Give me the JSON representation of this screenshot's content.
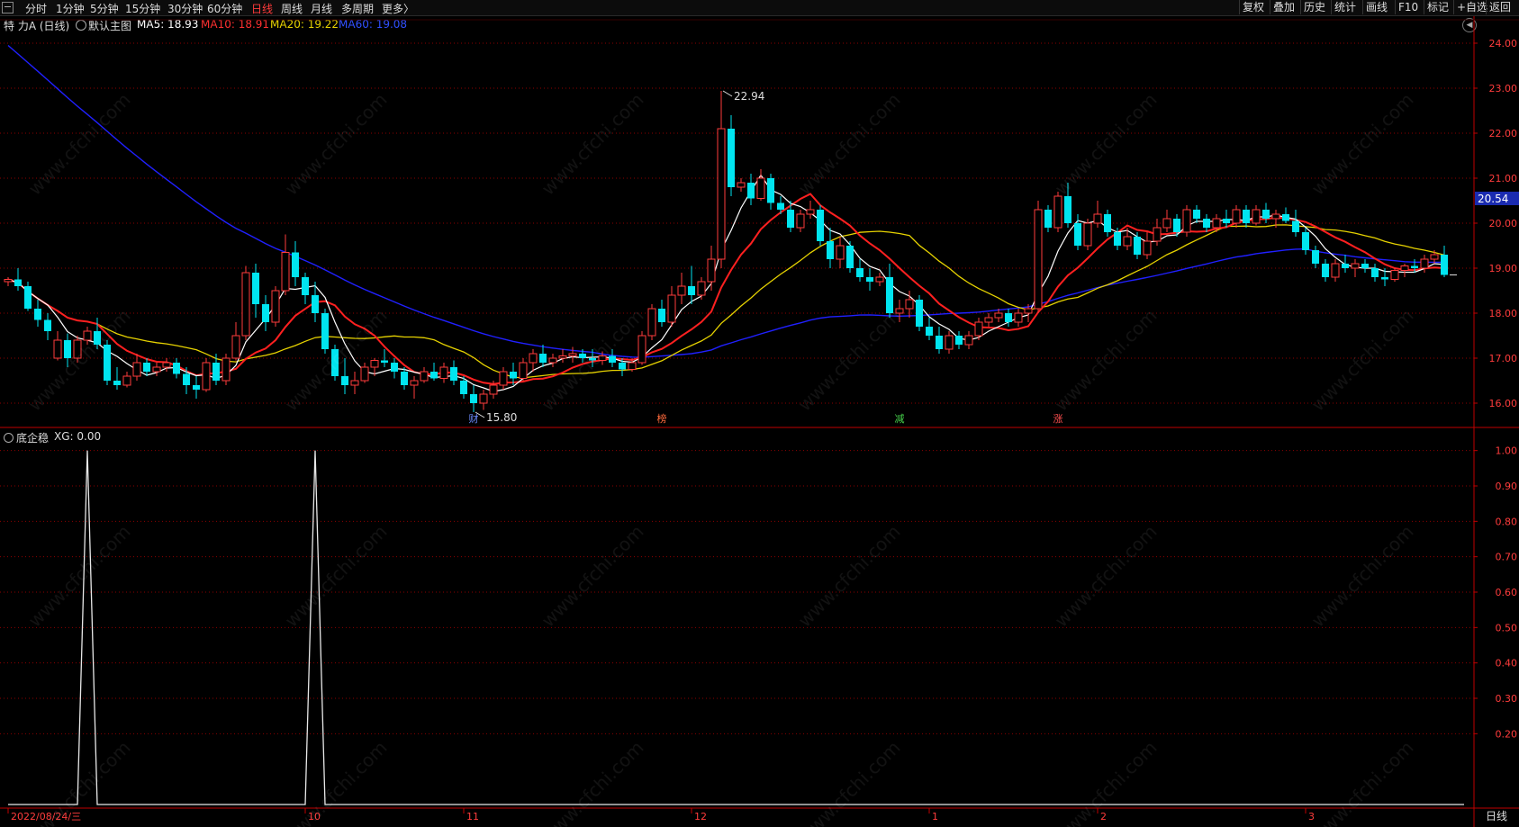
{
  "toolbar": {
    "left": [
      "分时",
      "1分钟",
      "5分钟",
      "15分钟",
      "30分钟",
      "60分钟",
      "日线",
      "周线",
      "月线",
      "多周期",
      "更多〉"
    ],
    "active": "日线",
    "right": [
      "复权",
      "叠加",
      "历史",
      "统计",
      "画线",
      "F10",
      "标记",
      "+自选",
      "返回"
    ]
  },
  "header": {
    "stock": "特 力A (日线)",
    "main_chart": "默认主图",
    "ma5": "MA5: 18.93",
    "ma10": "MA10: 18.91",
    "ma20": "MA20: 19.22",
    "ma60": "MA60: 19.08"
  },
  "indicator": {
    "label": "底企稳",
    "value": "XG: 0.00"
  },
  "colors": {
    "up": "#ff3c3c",
    "down": "#00e5f0",
    "ma5": "#ffffff",
    "ma10": "#ff2020",
    "ma20": "#e6d200",
    "ma60": "#2020ff",
    "grid": "#8b0000",
    "axis": "#c00000"
  },
  "chart_data": [
    {
      "type": "candlestick",
      "title": "特 力A (日线)",
      "ylim": [
        15.5,
        24.2
      ],
      "y_ticks": [
        16,
        17,
        18,
        19,
        20,
        21,
        22,
        23,
        24
      ],
      "y_tick_labels": [
        "16.00",
        "17.00",
        "18.00",
        "19.00",
        "20.00",
        "21.00",
        "22.00",
        "23.00",
        "24.00"
      ],
      "current_price": "20.54",
      "annotations": {
        "high": "22.94",
        "low": "15.80"
      },
      "event_markers": [
        "财",
        "榜",
        "减",
        "涨"
      ],
      "ohlc": [
        [
          18.7,
          18.8,
          18.6,
          18.75
        ],
        [
          18.75,
          19.0,
          18.5,
          18.6
        ],
        [
          18.6,
          18.7,
          18.05,
          18.1
        ],
        [
          18.1,
          18.3,
          17.7,
          17.85
        ],
        [
          17.85,
          18.0,
          17.4,
          17.6
        ],
        [
          17.0,
          17.6,
          16.95,
          17.4
        ],
        [
          17.4,
          17.55,
          16.8,
          17.0
        ],
        [
          17.0,
          17.5,
          16.9,
          17.4
        ],
        [
          17.4,
          17.7,
          17.3,
          17.6
        ],
        [
          17.6,
          17.9,
          17.2,
          17.3
        ],
        [
          17.3,
          17.4,
          16.4,
          16.5
        ],
        [
          16.5,
          16.8,
          16.3,
          16.4
        ],
        [
          16.4,
          16.7,
          16.35,
          16.6
        ],
        [
          16.6,
          17.1,
          16.5,
          16.9
        ],
        [
          16.9,
          17.0,
          16.6,
          16.7
        ],
        [
          16.7,
          16.9,
          16.6,
          16.8
        ],
        [
          16.8,
          17.0,
          16.7,
          16.9
        ],
        [
          16.9,
          17.0,
          16.55,
          16.65
        ],
        [
          16.65,
          16.8,
          16.2,
          16.4
        ],
        [
          16.4,
          16.6,
          16.1,
          16.3
        ],
        [
          16.3,
          17.0,
          16.25,
          16.9
        ],
        [
          16.9,
          17.1,
          16.4,
          16.5
        ],
        [
          16.5,
          17.1,
          16.4,
          17.0
        ],
        [
          17.0,
          17.8,
          16.95,
          17.5
        ],
        [
          17.5,
          19.05,
          17.4,
          18.9
        ],
        [
          18.9,
          19.1,
          17.9,
          18.2
        ],
        [
          18.2,
          18.4,
          17.6,
          17.8
        ],
        [
          17.8,
          18.6,
          17.7,
          18.5
        ],
        [
          18.5,
          19.75,
          18.4,
          19.35
        ],
        [
          19.35,
          19.6,
          18.6,
          18.8
        ],
        [
          18.8,
          18.9,
          18.2,
          18.4
        ],
        [
          18.4,
          18.7,
          17.8,
          18.0
        ],
        [
          18.0,
          18.1,
          17.1,
          17.2
        ],
        [
          17.2,
          17.3,
          16.5,
          16.6
        ],
        [
          16.6,
          17.0,
          16.2,
          16.4
        ],
        [
          16.4,
          16.7,
          16.2,
          16.5
        ],
        [
          16.5,
          16.9,
          16.45,
          16.8
        ],
        [
          16.8,
          17.0,
          16.6,
          16.95
        ],
        [
          16.95,
          17.2,
          16.8,
          16.9
        ],
        [
          16.9,
          17.0,
          16.55,
          16.7
        ],
        [
          16.7,
          16.8,
          16.3,
          16.4
        ],
        [
          16.4,
          16.6,
          16.1,
          16.5
        ],
        [
          16.5,
          16.8,
          16.45,
          16.7
        ],
        [
          16.7,
          16.9,
          16.5,
          16.55
        ],
        [
          16.55,
          16.9,
          16.45,
          16.8
        ],
        [
          16.8,
          16.95,
          16.4,
          16.5
        ],
        [
          16.5,
          16.6,
          16.1,
          16.2
        ],
        [
          16.2,
          16.4,
          15.8,
          16.0
        ],
        [
          16.0,
          16.3,
          15.85,
          16.2
        ],
        [
          16.2,
          16.5,
          16.1,
          16.4
        ],
        [
          16.4,
          16.8,
          16.3,
          16.7
        ],
        [
          16.7,
          16.9,
          16.4,
          16.55
        ],
        [
          16.55,
          17.0,
          16.5,
          16.9
        ],
        [
          16.9,
          17.2,
          16.7,
          17.1
        ],
        [
          17.1,
          17.3,
          16.8,
          16.9
        ],
        [
          16.9,
          17.1,
          16.8,
          17.0
        ],
        [
          17.0,
          17.2,
          16.9,
          17.05
        ],
        [
          17.05,
          17.25,
          16.9,
          17.1
        ],
        [
          17.1,
          17.2,
          16.9,
          17.0
        ],
        [
          17.0,
          17.2,
          16.8,
          16.95
        ],
        [
          16.95,
          17.15,
          16.85,
          17.05
        ],
        [
          17.05,
          17.2,
          16.8,
          16.9
        ],
        [
          16.9,
          17.0,
          16.6,
          16.75
        ],
        [
          16.75,
          17.0,
          16.7,
          16.9
        ],
        [
          16.9,
          17.6,
          16.85,
          17.5
        ],
        [
          17.5,
          18.2,
          17.4,
          18.1
        ],
        [
          18.1,
          18.3,
          17.7,
          17.8
        ],
        [
          17.8,
          18.6,
          17.7,
          18.4
        ],
        [
          18.4,
          18.9,
          18.2,
          18.6
        ],
        [
          18.6,
          19.05,
          18.2,
          18.4
        ],
        [
          18.4,
          18.8,
          18.3,
          18.7
        ],
        [
          18.7,
          19.5,
          18.5,
          19.2
        ],
        [
          19.2,
          22.94,
          19.0,
          22.1
        ],
        [
          22.1,
          22.4,
          20.6,
          20.8
        ],
        [
          20.8,
          21.0,
          20.7,
          20.9
        ],
        [
          20.9,
          21.1,
          20.4,
          20.55
        ],
        [
          20.55,
          21.2,
          20.5,
          21.0
        ],
        [
          21.0,
          21.1,
          20.3,
          20.45
        ],
        [
          20.45,
          20.6,
          20.2,
          20.3
        ],
        [
          20.3,
          20.5,
          19.8,
          19.9
        ],
        [
          19.9,
          20.3,
          19.8,
          20.2
        ],
        [
          20.2,
          20.5,
          20.1,
          20.3
        ],
        [
          20.3,
          20.4,
          19.5,
          19.6
        ],
        [
          19.6,
          19.9,
          19.0,
          19.2
        ],
        [
          19.2,
          19.7,
          19.0,
          19.5
        ],
        [
          19.5,
          19.6,
          18.9,
          19.0
        ],
        [
          19.0,
          19.2,
          18.7,
          18.8
        ],
        [
          18.8,
          19.0,
          18.5,
          18.7
        ],
        [
          18.7,
          18.9,
          18.6,
          18.8
        ],
        [
          18.8,
          19.1,
          17.9,
          18.0
        ],
        [
          18.0,
          18.3,
          17.8,
          18.1
        ],
        [
          18.1,
          18.5,
          17.9,
          18.3
        ],
        [
          18.3,
          18.4,
          17.6,
          17.7
        ],
        [
          17.7,
          17.9,
          17.4,
          17.5
        ],
        [
          17.5,
          17.7,
          17.1,
          17.2
        ],
        [
          17.2,
          17.6,
          17.1,
          17.5
        ],
        [
          17.5,
          17.6,
          17.2,
          17.3
        ],
        [
          17.3,
          17.6,
          17.2,
          17.5
        ],
        [
          17.5,
          17.9,
          17.4,
          17.8
        ],
        [
          17.8,
          18.0,
          17.7,
          17.9
        ],
        [
          17.9,
          18.1,
          17.8,
          18.0
        ],
        [
          18.0,
          18.1,
          17.7,
          17.8
        ],
        [
          17.8,
          18.1,
          17.7,
          18.0
        ],
        [
          18.0,
          18.2,
          17.8,
          18.1
        ],
        [
          18.1,
          20.5,
          18.0,
          20.3
        ],
        [
          20.3,
          20.4,
          19.8,
          19.9
        ],
        [
          19.9,
          20.7,
          19.8,
          20.6
        ],
        [
          20.6,
          20.9,
          19.9,
          20.0
        ],
        [
          20.0,
          20.2,
          19.4,
          19.5
        ],
        [
          19.5,
          20.1,
          19.4,
          20.0
        ],
        [
          20.0,
          20.5,
          19.9,
          20.2
        ],
        [
          20.2,
          20.3,
          19.7,
          19.8
        ],
        [
          19.8,
          19.9,
          19.4,
          19.5
        ],
        [
          19.5,
          19.9,
          19.4,
          19.7
        ],
        [
          19.7,
          19.8,
          19.2,
          19.3
        ],
        [
          19.3,
          19.8,
          19.2,
          19.6
        ],
        [
          19.6,
          20.1,
          19.5,
          19.9
        ],
        [
          19.9,
          20.3,
          19.8,
          20.1
        ],
        [
          20.1,
          20.2,
          19.7,
          19.8
        ],
        [
          19.8,
          20.4,
          19.7,
          20.3
        ],
        [
          20.3,
          20.4,
          20.0,
          20.1
        ],
        [
          20.1,
          20.2,
          19.8,
          19.9
        ],
        [
          19.9,
          20.2,
          19.8,
          20.1
        ],
        [
          20.1,
          20.3,
          19.9,
          20.0
        ],
        [
          20.0,
          20.4,
          19.9,
          20.3
        ],
        [
          20.3,
          20.4,
          19.9,
          20.0
        ],
        [
          20.0,
          20.4,
          19.95,
          20.3
        ],
        [
          20.3,
          20.45,
          20.0,
          20.1
        ],
        [
          20.1,
          20.3,
          19.9,
          20.2
        ],
        [
          20.2,
          20.35,
          20.0,
          20.05
        ],
        [
          20.05,
          20.3,
          19.7,
          19.8
        ],
        [
          19.8,
          19.9,
          19.3,
          19.4
        ],
        [
          19.4,
          19.5,
          19.0,
          19.1
        ],
        [
          19.1,
          19.2,
          18.7,
          18.8
        ],
        [
          18.8,
          19.2,
          18.7,
          19.1
        ],
        [
          19.1,
          19.3,
          18.9,
          19.0
        ],
        [
          19.0,
          19.2,
          18.8,
          19.1
        ],
        [
          19.1,
          19.2,
          18.9,
          19.0
        ],
        [
          19.0,
          19.1,
          18.7,
          18.8
        ],
        [
          18.8,
          19.0,
          18.6,
          18.75
        ],
        [
          18.75,
          19.0,
          18.7,
          18.95
        ],
        [
          18.95,
          19.1,
          18.8,
          19.05
        ],
        [
          19.05,
          19.2,
          18.9,
          19.0
        ],
        [
          19.0,
          19.3,
          18.9,
          19.2
        ],
        [
          19.2,
          19.4,
          19.1,
          19.3
        ],
        [
          19.3,
          19.5,
          18.8,
          18.85
        ]
      ]
    },
    {
      "type": "line",
      "title": "底企稳",
      "series": [
        {
          "name": "XG",
          "values": [
            0,
            0,
            0,
            0,
            0,
            0,
            0,
            0,
            0,
            0,
            0,
            0,
            0,
            0,
            0,
            0,
            0,
            0,
            0,
            0,
            0,
            0,
            0,
            0,
            0,
            0,
            0,
            0,
            0,
            0,
            0,
            0,
            0,
            0,
            0,
            0,
            0,
            0,
            0,
            0,
            0,
            0,
            0,
            0,
            0,
            0,
            0,
            0,
            0,
            0,
            0,
            0,
            0,
            0,
            0,
            0,
            0,
            0,
            0,
            0,
            0,
            0,
            0,
            0,
            0,
            0,
            0,
            0,
            0,
            0,
            0,
            0,
            0,
            0,
            0,
            0,
            0,
            0,
            0,
            0,
            0,
            0,
            0,
            0,
            0,
            0,
            0,
            0,
            0,
            0,
            0,
            0,
            0,
            0,
            0,
            0,
            0,
            0,
            0,
            0,
            0,
            0,
            0,
            0,
            0,
            0,
            0,
            0,
            0,
            0,
            0,
            0,
            0,
            0,
            0,
            0,
            0,
            0,
            0,
            0,
            0,
            0,
            0,
            0,
            0,
            0,
            0,
            0,
            0,
            0,
            0,
            0,
            0,
            0,
            0,
            0,
            0,
            0,
            0,
            0,
            0,
            0,
            0,
            0,
            0,
            0,
            0,
            0
          ]
        }
      ],
      "peaks": [
        {
          "index": 8,
          "value": 1.0
        },
        {
          "index": 31,
          "value": 1.0
        }
      ],
      "ylim": [
        0,
        1.05
      ],
      "y_ticks": [
        0.2,
        0.3,
        0.4,
        0.5,
        0.6,
        0.7,
        0.8,
        0.9,
        1.0
      ],
      "y_tick_labels": [
        "0.20",
        "0.30",
        "0.40",
        "0.50",
        "0.60",
        "0.70",
        "0.80",
        "0.90",
        "1.00"
      ],
      "x_labels": [
        "2022/08/24/三",
        "10",
        "11",
        "12",
        "1",
        "2",
        "3"
      ],
      "x_label_index": [
        0,
        30,
        46,
        69,
        93,
        110,
        131
      ],
      "period_label": "日线"
    }
  ]
}
